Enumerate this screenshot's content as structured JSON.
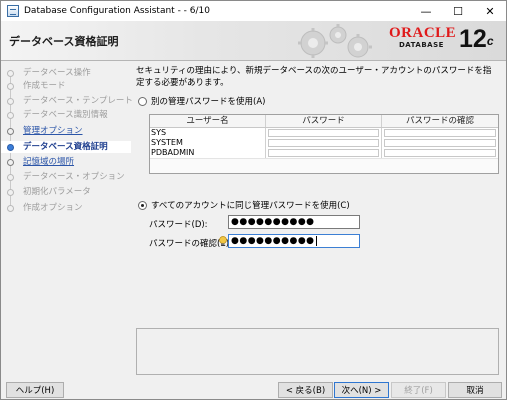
{
  "window": {
    "title": "Database Configuration Assistant - - 6/10",
    "controls": {
      "minimize": "—",
      "maximize": "☐",
      "close": "✕"
    }
  },
  "header": {
    "page_title": "データベース資格証明",
    "brand": {
      "name": "ORACLE",
      "product": "DATABASE",
      "version": "12",
      "version_suffix": "c"
    }
  },
  "sidebar": {
    "steps": [
      {
        "label": "データベース操作",
        "state": "disabled"
      },
      {
        "label": "作成モード",
        "state": "disabled"
      },
      {
        "label": "データベース・テンプレート",
        "state": "disabled"
      },
      {
        "label": "データベース識別情報",
        "state": "disabled"
      },
      {
        "label": "管理オプション",
        "state": "link"
      },
      {
        "label": "データベース資格証明",
        "state": "active"
      },
      {
        "label": "記憶域の場所",
        "state": "link"
      },
      {
        "label": "データベース・オプション",
        "state": "disabled"
      },
      {
        "label": "初期化パラメータ",
        "state": "disabled"
      },
      {
        "label": "作成オプション",
        "state": "disabled"
      }
    ]
  },
  "content": {
    "intro": "セキュリティの理由により、新規データベースの次のユーザー・アカウントのパスワードを指定する必要があります。",
    "option_separate": "別の管理パスワードを使用(A)",
    "option_same": "すべてのアカウントに同じ管理パスワードを使用(C)",
    "grid": {
      "headers": [
        "ユーザー名",
        "パスワード",
        "パスワードの確認"
      ],
      "rows": [
        {
          "user": "SYS"
        },
        {
          "user": "SYSTEM"
        },
        {
          "user": "PDBADMIN"
        }
      ]
    },
    "password_label": "パスワード(D):",
    "password_value": "●●●●●●●●●●",
    "confirm_label": "パスワードの確認(E):",
    "confirm_value": "●●●●●●●●●●"
  },
  "footer": {
    "help": "ヘルプ(H)",
    "back": "< 戻る(B)",
    "next": "次へ(N) >",
    "finish": "終了(F)",
    "cancel": "取消"
  }
}
